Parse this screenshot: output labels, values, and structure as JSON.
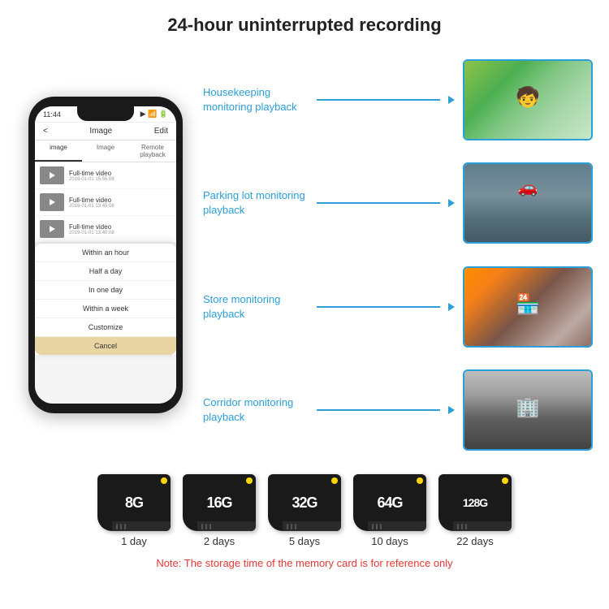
{
  "header": {
    "title": "24-hour uninterrupted recording"
  },
  "phone": {
    "status_time": "11:44",
    "nav_back": "<",
    "nav_title": "Image",
    "nav_edit": "Edit",
    "tabs": [
      "image",
      "Image",
      "Remote playback"
    ],
    "list_items": [
      {
        "title": "Full-time video",
        "date": "2019-01-01 15:55:08"
      },
      {
        "title": "Full-time video",
        "date": "2019-01-01 13:45:08"
      },
      {
        "title": "Full-time video",
        "date": "2019-01-01 13:40:08"
      }
    ],
    "dropdown": {
      "items": [
        "Within an hour",
        "Half a day",
        "In one day",
        "Within a week",
        "Customize"
      ],
      "cancel": "Cancel"
    }
  },
  "monitoring": {
    "items": [
      {
        "label": "Housekeeping monitoring playback",
        "img_type": "child"
      },
      {
        "label": "Parking lot monitoring playback",
        "img_type": "parking"
      },
      {
        "label": "Store monitoring playback",
        "img_type": "store"
      },
      {
        "label": "Corridor monitoring playback",
        "img_type": "corridor"
      }
    ]
  },
  "sd_cards": {
    "items": [
      {
        "size": "8G",
        "days": "1 day"
      },
      {
        "size": "16G",
        "days": "2 days"
      },
      {
        "size": "32G",
        "days": "5 days"
      },
      {
        "size": "64G",
        "days": "10 days"
      },
      {
        "size": "128G",
        "days": "22 days"
      }
    ],
    "note": "Note: The storage time of the memory card is for reference only"
  }
}
